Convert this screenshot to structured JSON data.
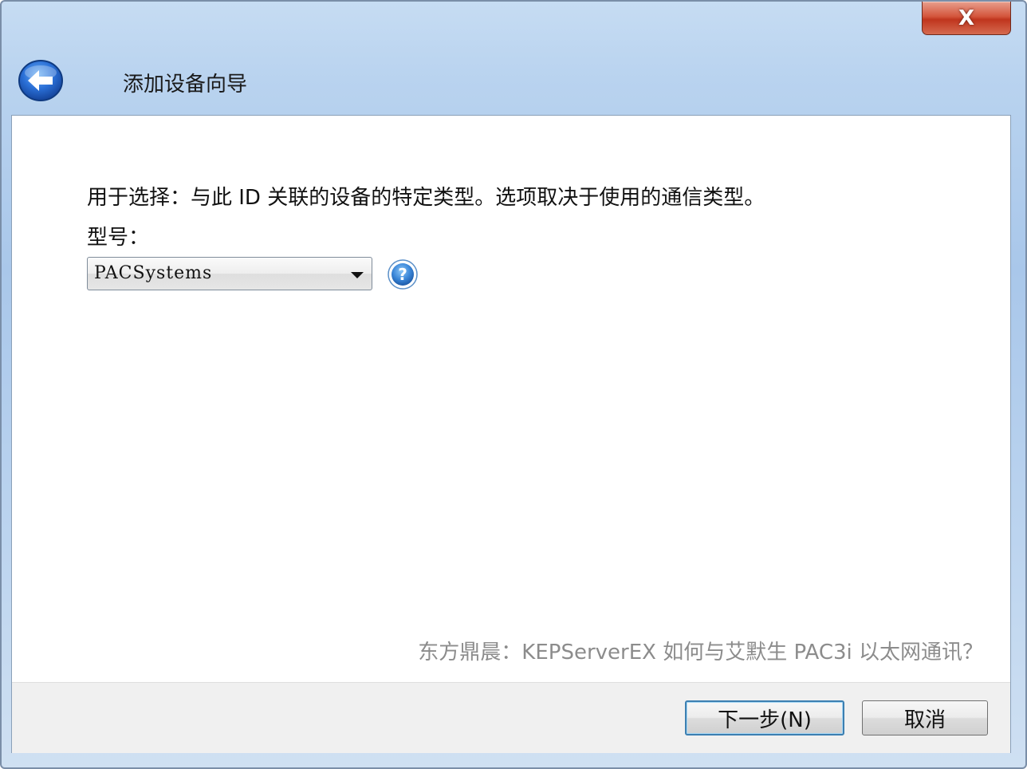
{
  "window": {
    "title": "添加设备向导",
    "close_label": "X"
  },
  "page": {
    "description": "用于选择：与此 ID 关联的设备的特定类型。选项取决于使用的通信类型。",
    "model_label": "型号：",
    "model_value": "PACSystems"
  },
  "watermark": "东方鼎晨：KEPServerEX 如何与艾默生 PAC3i 以太网通讯？",
  "buttons": {
    "next": "下一步(N)",
    "cancel": "取消"
  },
  "icons": {
    "back": "back-arrow-icon",
    "help": "help-icon",
    "dropdown": "chevron-down-icon",
    "close": "close-icon"
  },
  "colors": {
    "accent": "#2f6fd0",
    "close": "#c7452b"
  }
}
